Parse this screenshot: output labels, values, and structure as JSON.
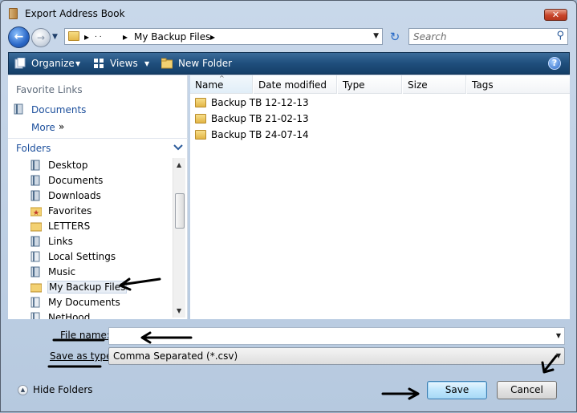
{
  "window": {
    "title": "Export Address Book",
    "close_glyph": "✕"
  },
  "address_bar": {
    "segments": [
      ". .",
      "My Backup Files"
    ],
    "search_placeholder": "Search"
  },
  "toolbar": {
    "organize": "Organize",
    "views": "Views",
    "new_folder": "New Folder",
    "help": "?"
  },
  "favorite_links": {
    "title": "Favorite Links",
    "items": [
      {
        "label": "Documents"
      },
      {
        "label": "More",
        "suffix": "»"
      }
    ]
  },
  "folders": {
    "title": "Folders",
    "items": [
      {
        "label": "Desktop",
        "icon": "library-icon"
      },
      {
        "label": "Documents",
        "icon": "library-icon"
      },
      {
        "label": "Downloads",
        "icon": "library-icon"
      },
      {
        "label": "Favorites",
        "icon": "star-folder-icon"
      },
      {
        "label": "LETTERS",
        "icon": "folder-icon"
      },
      {
        "label": "Links",
        "icon": "library-icon"
      },
      {
        "label": "Local Settings",
        "icon": "shortcut-folder-icon"
      },
      {
        "label": "Music",
        "icon": "music-library-icon"
      },
      {
        "label": "My Backup Files",
        "icon": "folder-icon",
        "selected": true
      },
      {
        "label": "My Documents",
        "icon": "shortcut-folder-icon"
      },
      {
        "label": "NetHood",
        "icon": "shortcut-folder-icon"
      }
    ]
  },
  "file_list": {
    "columns": [
      "Name",
      "Date modified",
      "Type",
      "Size",
      "Tags"
    ],
    "sort_column": "Name",
    "rows": [
      {
        "name": "Backup TB 12-12-13"
      },
      {
        "name": "Backup TB 21-02-13"
      },
      {
        "name": "Backup TB 24-07-14"
      }
    ]
  },
  "save_panel": {
    "file_name_label": "File name:",
    "file_name_value": "",
    "save_type_label": "Save as type:",
    "save_type_value": "Comma Separated (*.csv)",
    "hide_folders": "Hide Folders",
    "save_button": "Save",
    "cancel_button": "Cancel"
  },
  "colors": {
    "toolbar": "#1f4e7c",
    "link": "#1c4f9c",
    "annotation": "#000000"
  }
}
